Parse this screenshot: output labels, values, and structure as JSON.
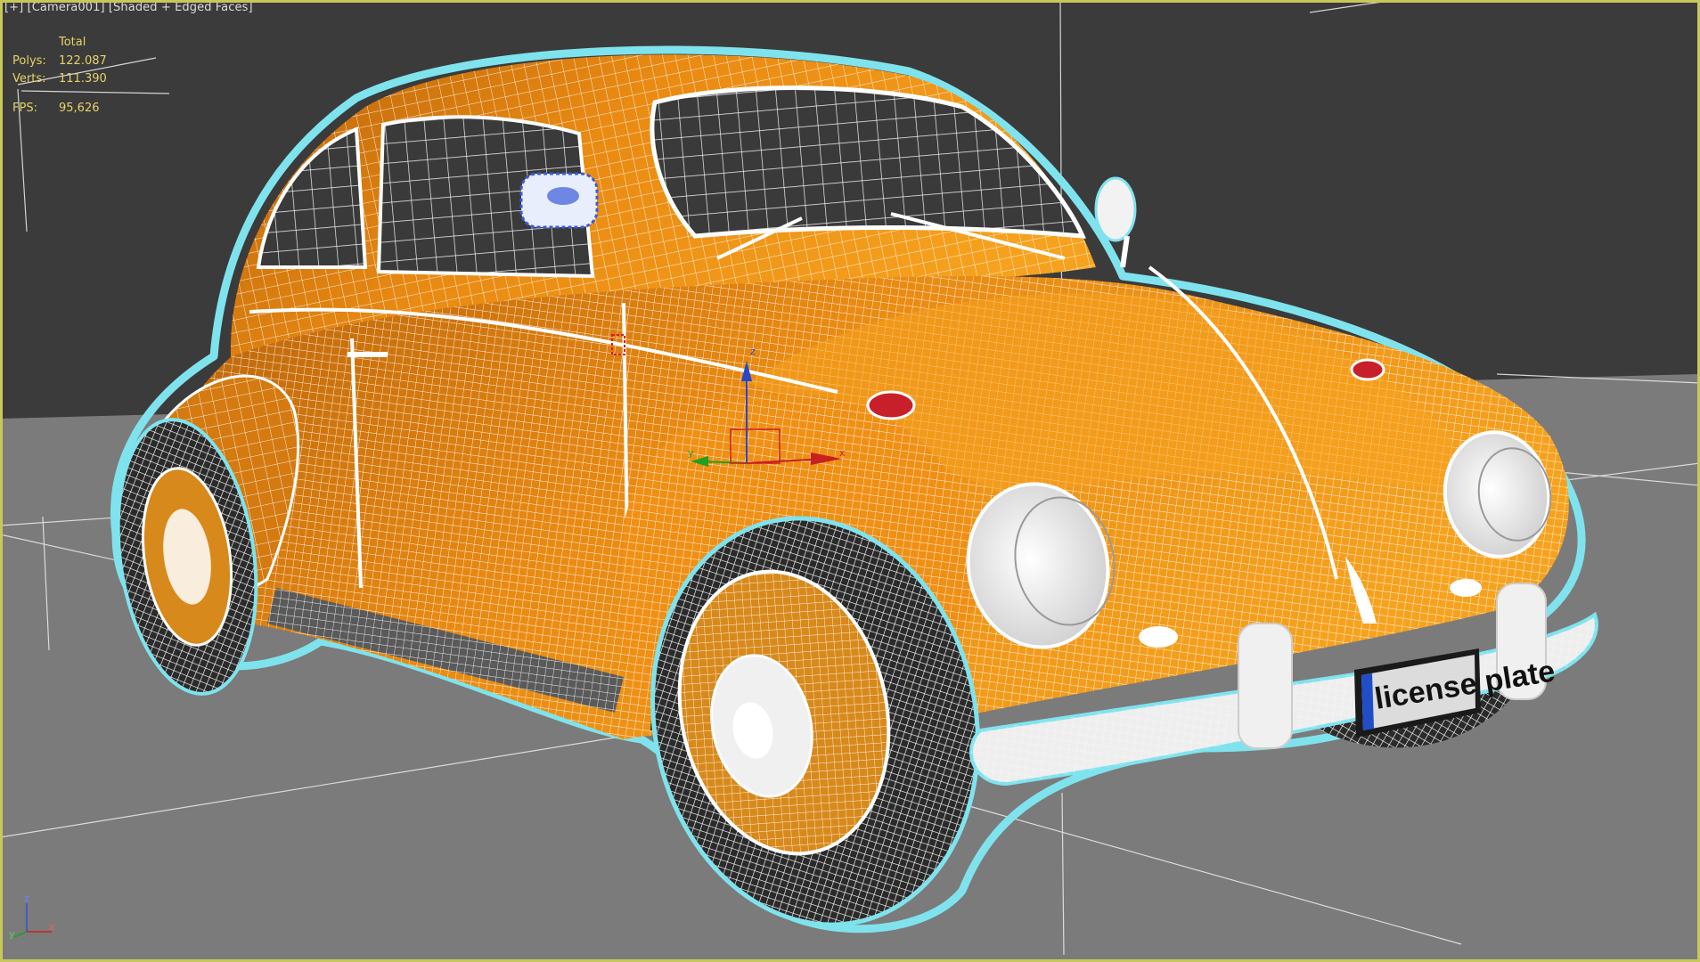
{
  "viewport": {
    "menu_plus": "[+]",
    "camera": "[Camera001]",
    "shading": "[Shaded + Edged Faces]"
  },
  "stats": {
    "header": "Total",
    "polys_label": "Polys:",
    "polys_value": "122.087",
    "verts_label": "Verts:",
    "verts_value": "111.390",
    "fps_label": "FPS:",
    "fps_value": "95,626"
  },
  "axis_tripod": {
    "x": "x",
    "y": "y",
    "z": "z"
  },
  "model": {
    "plate_text": "license plate",
    "body_color": "#f08c0e",
    "wire_color": "#ffffff",
    "selection_outline": "#7fe3ee"
  },
  "gizmo": {
    "x": "x",
    "y": "y",
    "z": "z"
  },
  "colors": {
    "viewport_border": "#c8c85a",
    "background_top": "#3b3b3b",
    "floor": "#7b7b7b",
    "stats_text": "#e8d26a"
  }
}
